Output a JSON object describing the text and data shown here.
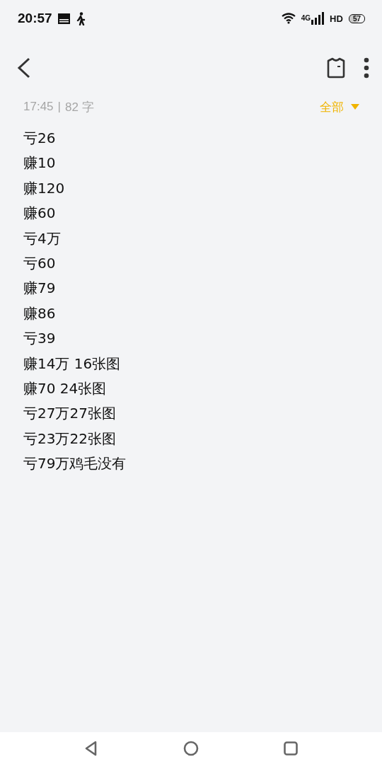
{
  "status_bar": {
    "time": "20:57",
    "network": "4G",
    "hd": "HD",
    "battery": "57"
  },
  "meta": {
    "time": "17:45",
    "separator": "|",
    "count": "82 字"
  },
  "filter": {
    "label": "全部"
  },
  "lines": [
    "亏26",
    "赚10",
    "赚120",
    "赚60",
    "亏4万",
    "亏60",
    "赚79",
    "赚86",
    "亏39",
    "赚14万 16张图",
    "赚70 24张图",
    "亏27万27张图",
    "亏23万22张图",
    "亏79万鸡毛没有"
  ]
}
